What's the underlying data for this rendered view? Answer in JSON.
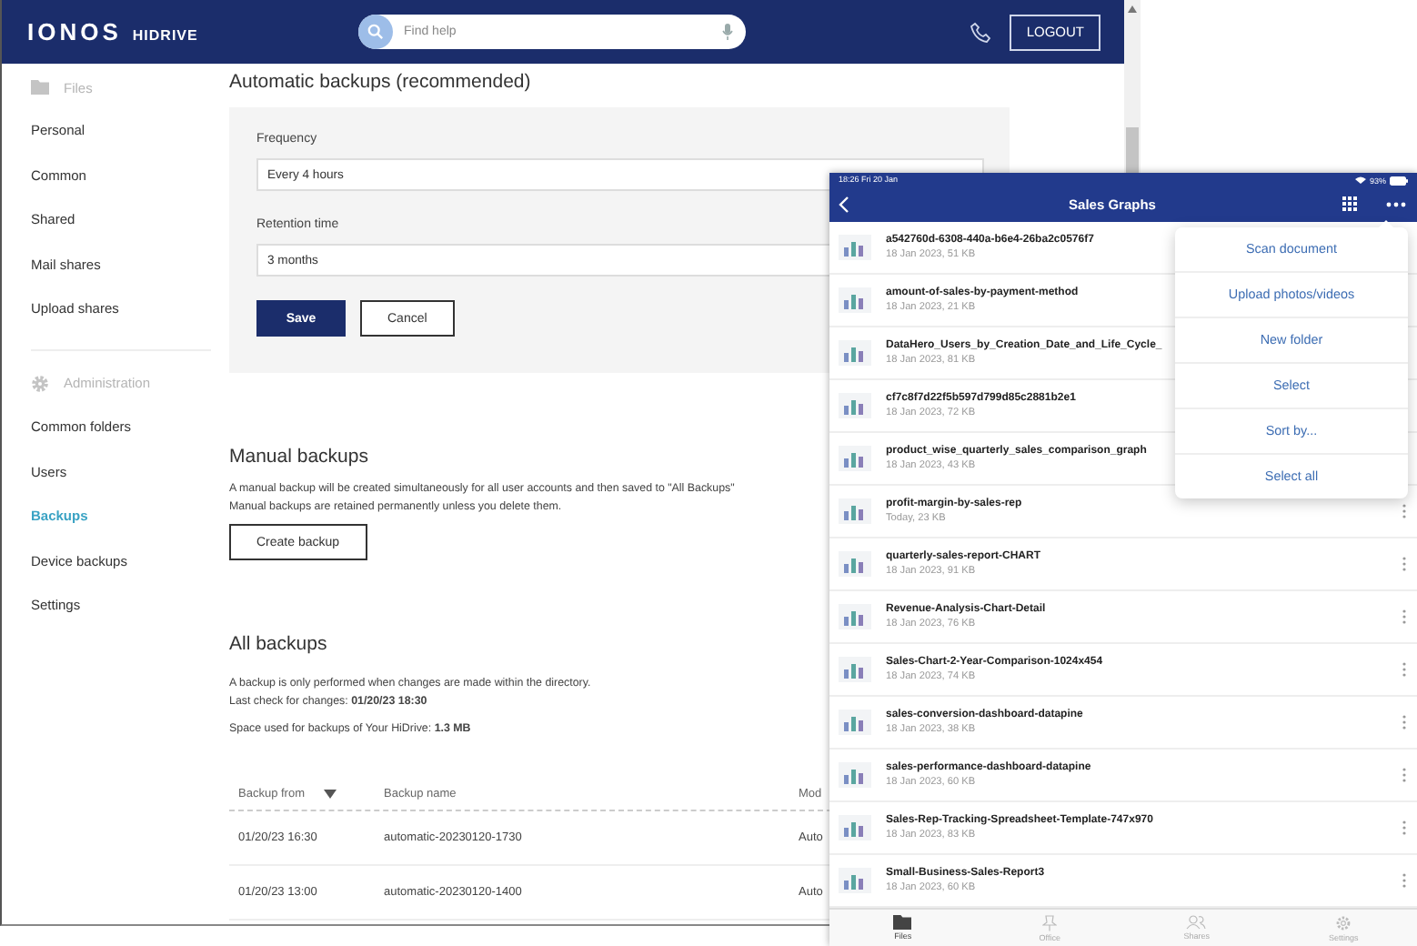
{
  "header": {
    "logo": "IONOS",
    "product": "HIDRIVE",
    "search": {
      "placeholder": "Find help"
    },
    "logout": "LOGOUT"
  },
  "sidebar": {
    "sections": [
      {
        "title": "Files",
        "kind": "folder",
        "items": [
          {
            "label": "Personal",
            "selected": false
          },
          {
            "label": "Common",
            "selected": false
          },
          {
            "label": "Shared",
            "selected": false
          },
          {
            "label": "Mail shares",
            "selected": false
          },
          {
            "label": "Upload shares",
            "selected": false
          }
        ]
      },
      {
        "title": "Administration",
        "kind": "gear",
        "items": [
          {
            "label": "Common folders",
            "selected": false
          },
          {
            "label": "Users",
            "selected": false
          },
          {
            "label": "Backups",
            "selected": true
          },
          {
            "label": "Device backups",
            "selected": false
          },
          {
            "label": "Settings",
            "selected": false
          }
        ]
      }
    ]
  },
  "automatic": {
    "title": "Automatic backups (recommended)",
    "fields": [
      {
        "label": "Frequency",
        "value": "Every 4 hours"
      },
      {
        "label": "Retention time",
        "value": "3 months"
      }
    ],
    "buttons": [
      {
        "label": "Save",
        "kind": "primary"
      },
      {
        "label": "Cancel",
        "kind": "secondary"
      }
    ]
  },
  "manual": {
    "title": "Manual backups",
    "lines": [
      "A manual backup will be created simultaneously for all user accounts and then saved to \"All Backups\"",
      "Manual backups are retained permanently unless you delete them."
    ],
    "button": "Create backup"
  },
  "all_backups": {
    "title": "All backups",
    "note": "A backup is only performed when changes are made within the directory.",
    "last_check": "Last check for changes: **01/20/23 18:30**",
    "space": "Space used for backups of Your HiDrive: **1.3 MB**",
    "table": {
      "columns": [
        {
          "label": "Backup from",
          "sorted": true
        },
        {
          "label": "Backup name",
          "sorted": false
        },
        {
          "label": "Mod",
          "sorted": false
        }
      ],
      "rows": [
        [
          "01/20/23 16:30",
          "automatic-20230120-1730",
          "Auto"
        ],
        [
          "01/20/23 13:00",
          "automatic-20230120-1400",
          "Auto"
        ]
      ]
    }
  },
  "tablet": {
    "status": {
      "time": "18:26  Fri 20 Jan",
      "battery": "93%"
    },
    "title": "Sales Graphs",
    "menu": [
      "Scan document",
      "Upload photos/videos",
      "New folder",
      "Select",
      "Sort by...",
      "Select all"
    ],
    "files": [
      {
        "name": "a542760d-6308-440a-b6e4-26ba2c0576f7",
        "meta": "18 Jan 2023, 51 KB"
      },
      {
        "name": "amount-of-sales-by-payment-method",
        "meta": "18 Jan 2023, 21 KB"
      },
      {
        "name": "DataHero_Users_by_Creation_Date_and_Life_Cycle_",
        "meta": "18 Jan 2023, 81 KB"
      },
      {
        "name": "cf7c8f7d22f5b597d799d85c2881b2e1",
        "meta": "18 Jan 2023, 72 KB"
      },
      {
        "name": "product_wise_quarterly_sales_comparison_graph",
        "meta": "18 Jan 2023, 43 KB"
      },
      {
        "name": "profit-margin-by-sales-rep",
        "meta": "Today, 23 KB"
      },
      {
        "name": "quarterly-sales-report-CHART",
        "meta": "18 Jan 2023, 91 KB"
      },
      {
        "name": "Revenue-Analysis-Chart-Detail",
        "meta": "18 Jan 2023, 76 KB"
      },
      {
        "name": "Sales-Chart-2-Year-Comparison-1024x454",
        "meta": "18 Jan 2023, 74 KB"
      },
      {
        "name": "sales-conversion-dashboard-datapine",
        "meta": "18 Jan 2023, 38 KB"
      },
      {
        "name": "sales-performance-dashboard-datapine",
        "meta": "18 Jan 2023, 60 KB"
      },
      {
        "name": "Sales-Rep-Tracking-Spreadsheet-Template-747x970",
        "meta": "18 Jan 2023, 83 KB"
      },
      {
        "name": "Small-Business-Sales-Report3",
        "meta": "18 Jan 2023, 60 KB"
      }
    ],
    "tabs": [
      {
        "label": "Files",
        "selected": true
      },
      {
        "label": "Office",
        "selected": false
      },
      {
        "label": "Shares",
        "selected": false
      },
      {
        "label": "Settings",
        "selected": false
      }
    ]
  }
}
